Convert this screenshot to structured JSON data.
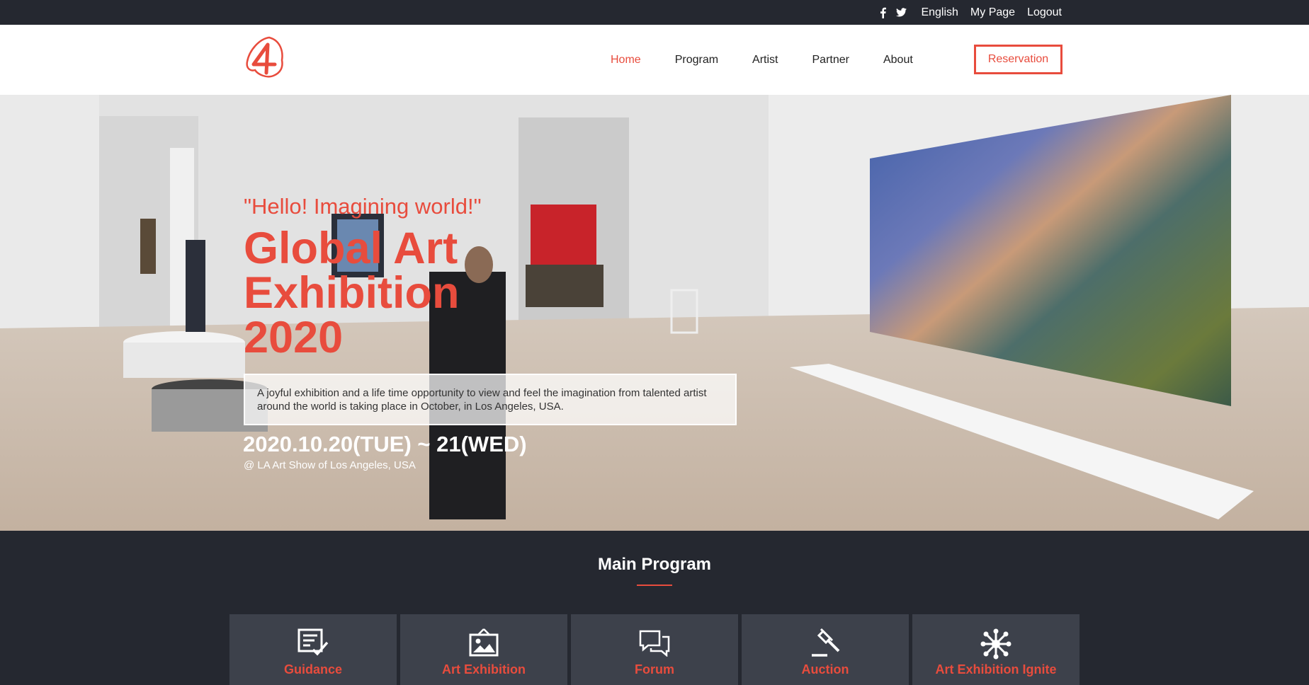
{
  "topbar": {
    "social": [
      "facebook-icon",
      "twitter-icon"
    ],
    "links": [
      "English",
      "My Page",
      "Logout"
    ]
  },
  "header": {
    "logo_text": "4",
    "nav": [
      "Home",
      "Program",
      "Artist",
      "Partner",
      "About"
    ],
    "active_nav": "Home",
    "reservation_label": "Reservation"
  },
  "hero": {
    "quote": "\"Hello! Imagining world!\"",
    "title_lines": [
      "Global Art",
      "Exhibition",
      "2020"
    ],
    "description": "A joyful exhibition and a life time opportunity to view and feel the imagination from talented artist around the world is taking place in October, in Los Angeles, USA.",
    "date": "2020.10.20(TUE) ~ 21(WED)",
    "venue": "@ LA Art Show of Los Angeles, USA"
  },
  "main_program": {
    "title": "Main Program",
    "cards": [
      {
        "label": "Guidance",
        "icon": "checklist-icon"
      },
      {
        "label": "Art Exhibition",
        "icon": "picture-icon"
      },
      {
        "label": "Forum",
        "icon": "chat-bubbles-icon"
      },
      {
        "label": "Auction",
        "icon": "gavel-icon"
      },
      {
        "label": "Art Exhibition Ignite",
        "icon": "network-icon"
      }
    ]
  },
  "colors": {
    "accent": "#e84c3d",
    "dark": "#252830",
    "card": "#3d414b"
  }
}
